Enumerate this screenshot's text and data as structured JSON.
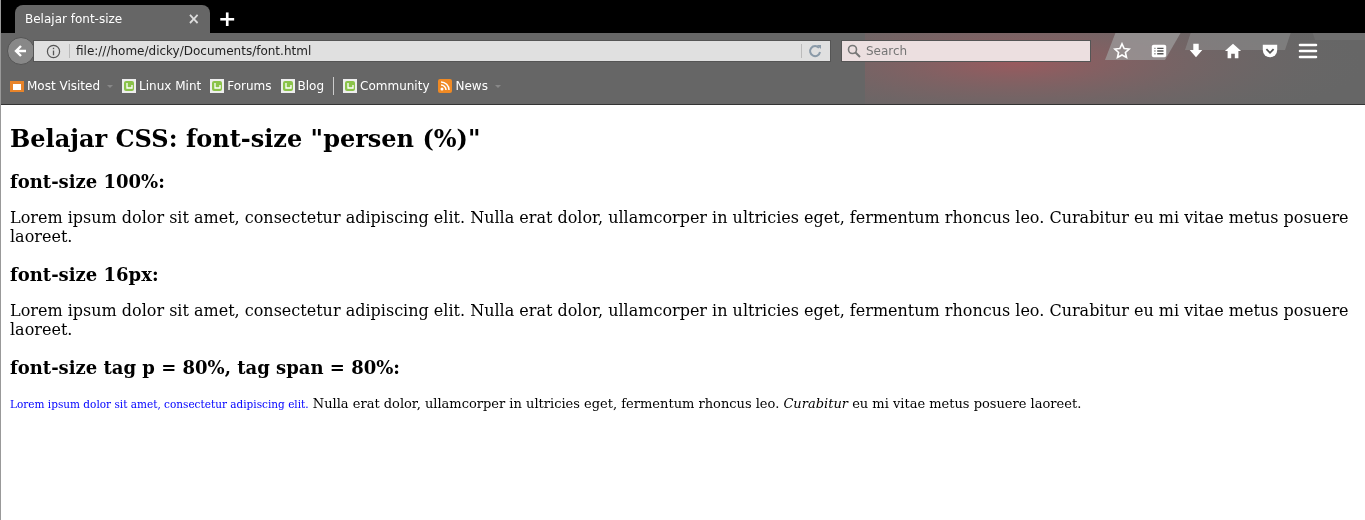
{
  "tabs": [
    {
      "title": "Belajar font-size",
      "selected": true,
      "close": "×"
    }
  ],
  "new_tab": "+",
  "address_bar": {
    "url": "file:///home/dicky/Documents/font.html"
  },
  "search": {
    "placeholder": "Search"
  },
  "bookmarks": [
    {
      "label": "Most Visited",
      "kind": "folder"
    },
    {
      "label": "Linux Mint",
      "kind": "mint"
    },
    {
      "label": "Forums",
      "kind": "mint"
    },
    {
      "label": "Blog",
      "kind": "mint"
    },
    {
      "kind": "separator"
    },
    {
      "label": "Community",
      "kind": "mint"
    },
    {
      "label": "News",
      "kind": "feed"
    }
  ],
  "page": [
    {
      "kind": "h1",
      "text": "Belajar CSS: font-size \"persen (%)\""
    },
    {
      "kind": "h3",
      "text": "font-size 100%:"
    },
    {
      "kind": "p",
      "text": "Lorem ipsum dolor sit amet, consectetur adipiscing elit. Nulla erat dolor, ullamcorper in ultricies eget, fermentum rhoncus leo. Curabitur eu mi vitae metus posuere laoreet."
    },
    {
      "kind": "h3",
      "text": "font-size 16px:"
    },
    {
      "kind": "p",
      "text": "Lorem ipsum dolor sit amet, consectetur adipiscing elit. Nulla erat dolor, ullamcorper in ultricies eget, fermentum rhoncus leo. Curabitur eu mi vitae metus posuere laoreet."
    },
    {
      "kind": "h3",
      "text": "font-size tag p = 80%, tag span = 80%:"
    },
    {
      "kind": "mixed",
      "span": "Lorem ipsum dolor sit amet, consectetur adipiscing elit.",
      "text": "Nulla erat dolor, ullamcorper in ultricies eget, fermentum rhoncus leo. *Curabitur* eu mi vitae metus posuere laoreet."
    }
  ]
}
